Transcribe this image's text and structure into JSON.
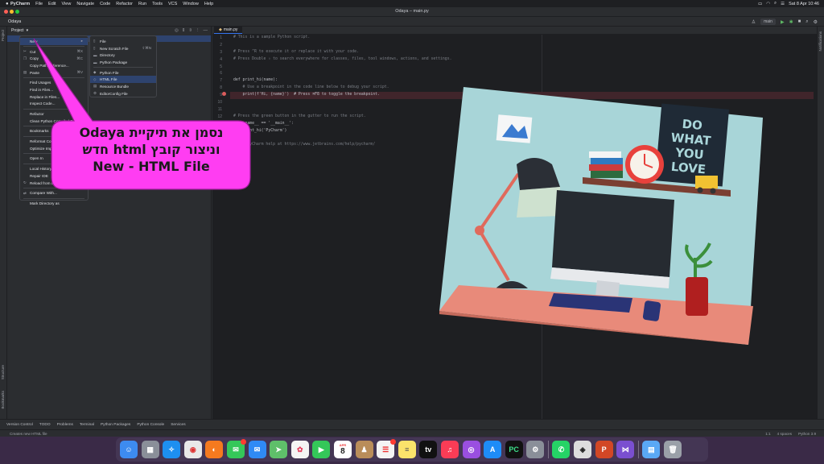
{
  "menubar": {
    "app": "PyCharm",
    "items": [
      "File",
      "Edit",
      "View",
      "Navigate",
      "Code",
      "Refactor",
      "Run",
      "Tools",
      "VCS",
      "Window",
      "Help"
    ],
    "datetime": "Sat 8 Apr 10:46"
  },
  "window": {
    "title": "Odaya – main.py",
    "breadcrumb": "Odaya",
    "run_config": "main"
  },
  "project_panel": {
    "title": "Project",
    "selected_row": ""
  },
  "editor": {
    "tab": "main.py",
    "line_numbers": [
      "1",
      "2",
      "3",
      "4",
      "5",
      "6",
      "7",
      "8",
      "9",
      "10",
      "11",
      "12",
      "13",
      "14",
      "15",
      "16",
      "17",
      "18"
    ],
    "lines": [
      "# This is a sample Python script.",
      "",
      "# Press ^R to execute it or replace it with your code.",
      "# Press Double ⇧ to search everywhere for classes, files, tool windows, actions, and settings.",
      "",
      "",
      "def print_hi(name):",
      "    # Use a breakpoint in the code line below to debug your script.",
      "    print(f'Hi, {name}')  # Press ⌘F8 to toggle the breakpoint.",
      "",
      "",
      "# Press the green button in the gutter to run the script.",
      "if __name__ == '__main__':",
      "    print_hi('PyCharm')",
      "",
      "# See PyCharm help at https://www.jetbrains.com/help/pycharm/",
      "",
      ""
    ]
  },
  "context_menu": {
    "items": [
      {
        "label": "New",
        "shortcut": "",
        "selected": true
      },
      {
        "label": "Cut",
        "shortcut": "⌘X"
      },
      {
        "label": "Copy",
        "shortcut": "⌘C"
      },
      {
        "label": "Copy Path/Reference...",
        "shortcut": ""
      },
      {
        "label": "Paste",
        "shortcut": "⌘V"
      },
      {
        "label": "Find Usages",
        "shortcut": ""
      },
      {
        "label": "Find in Files...",
        "shortcut": ""
      },
      {
        "label": "Replace in Files...",
        "shortcut": ""
      },
      {
        "label": "Inspect Code...",
        "shortcut": ""
      },
      {
        "label": "Refactor",
        "shortcut": ""
      },
      {
        "label": "Clean Python Compiled Files",
        "shortcut": ""
      },
      {
        "label": "Bookmarks",
        "shortcut": ""
      },
      {
        "label": "Reformat Code",
        "shortcut": ""
      },
      {
        "label": "Optimize Imports",
        "shortcut": ""
      },
      {
        "label": "Open In",
        "shortcut": ""
      },
      {
        "label": "Local History",
        "shortcut": ""
      },
      {
        "label": "Repair IDE",
        "shortcut": ""
      },
      {
        "label": "Reload from Disk",
        "shortcut": ""
      },
      {
        "label": "Compare With...",
        "shortcut": ""
      },
      {
        "label": "Mark Directory as",
        "shortcut": ""
      }
    ]
  },
  "submenu": {
    "items": [
      {
        "label": "File",
        "shortcut": ""
      },
      {
        "label": "New Scratch File",
        "shortcut": "⇧⌘N"
      },
      {
        "label": "Directory",
        "shortcut": ""
      },
      {
        "label": "Python Package",
        "shortcut": ""
      },
      {
        "label": "Python File",
        "shortcut": ""
      },
      {
        "label": "HTML File",
        "shortcut": "",
        "selected": true
      },
      {
        "label": "Resource Bundle",
        "shortcut": ""
      },
      {
        "label": "EditorConfig File",
        "shortcut": ""
      }
    ]
  },
  "callout": {
    "line1": "נסמן את תיקיית Odaya",
    "line2": "וניצור קובץ html חדש",
    "line3": "New - HTML File",
    "color": "#ff3df2"
  },
  "illustration": {
    "poster_text": [
      "DO",
      "WHAT",
      "YOU",
      "LOVE"
    ]
  },
  "bottom_tools": [
    "Version Control",
    "TODO",
    "Problems",
    "Terminal",
    "Python Packages",
    "Python Console",
    "Services"
  ],
  "statusbar": {
    "message": "Creates new HTML file",
    "right": [
      "1:1",
      "4 spaces",
      "Python 3.9"
    ]
  },
  "side_labels": {
    "project": "Project",
    "structure": "Structure",
    "bookmarks": "Bookmarks",
    "notifications": "Notifications"
  },
  "dock": {
    "calendar_day": "8",
    "calendar_month": "APR",
    "icons": [
      "finder-icon",
      "launchpad-icon",
      "safari-icon",
      "chrome-icon",
      "firefox-icon",
      "messages-icon",
      "mail-icon",
      "maps-icon",
      "photos-icon",
      "facetime-icon",
      "calendar-icon",
      "contacts-icon",
      "reminders-icon",
      "notes-icon",
      "appletv-icon",
      "music-icon",
      "podcasts-icon",
      "appstore-icon",
      "pycharm-icon",
      "systemsettings-icon",
      "whatsapp-icon",
      "unity-icon",
      "powerpoint-icon",
      "visualstudio-icon",
      "files-icon",
      "trash-icon"
    ]
  }
}
